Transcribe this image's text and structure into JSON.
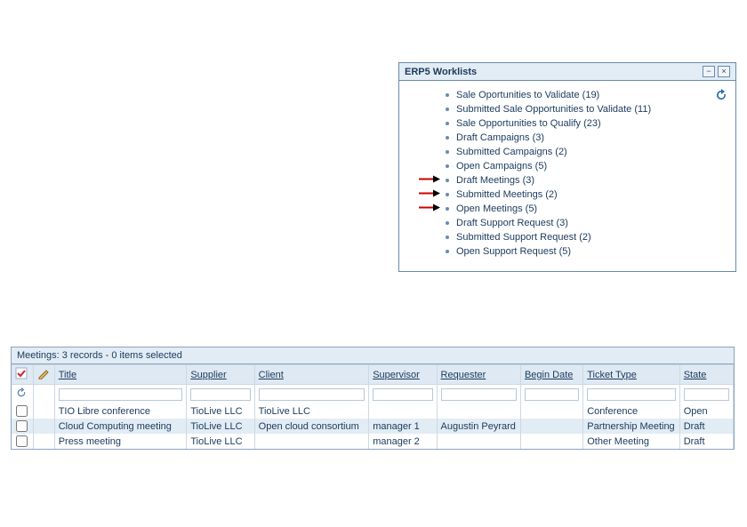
{
  "panel": {
    "title": "ERP5 Worklists",
    "minimize_glyph": "−",
    "close_glyph": "×",
    "items": [
      {
        "label": "Sale Oportunities to Validate (19)",
        "highlighted": false
      },
      {
        "label": "Submitted Sale Opportunities to Validate (11)",
        "highlighted": false
      },
      {
        "label": "Sale Opportunities to Qualify (23)",
        "highlighted": false
      },
      {
        "label": "Draft Campaigns (3)",
        "highlighted": false
      },
      {
        "label": "Submitted Campaigns (2)",
        "highlighted": false
      },
      {
        "label": "Open Campaigns (5)",
        "highlighted": false
      },
      {
        "label": "Draft Meetings (3)",
        "highlighted": true
      },
      {
        "label": "Submitted Meetings (2)",
        "highlighted": true
      },
      {
        "label": "Open Meetings (5)",
        "highlighted": true
      },
      {
        "label": "Draft Support Request (3)",
        "highlighted": false
      },
      {
        "label": "Submitted Support Request (2)",
        "highlighted": false
      },
      {
        "label": "Open Support Request (5)",
        "highlighted": false
      }
    ]
  },
  "meetings": {
    "caption": "Meetings: 3 records - 0 items selected",
    "columns": [
      "Title",
      "Supplier",
      "Client",
      "Supervisor",
      "Requester",
      "Begin Date",
      "Ticket Type",
      "State"
    ],
    "rows": [
      {
        "title": "TIO Libre conference",
        "supplier": "TioLive LLC",
        "client": "TioLive LLC",
        "supervisor": "",
        "requester": "",
        "begin_date": "",
        "ticket_type": "Conference",
        "state": "Open"
      },
      {
        "title": "Cloud Computing meeting",
        "supplier": "TioLive LLC",
        "client": "Open cloud consortium",
        "supervisor": "manager 1",
        "requester": "Augustin Peyrard",
        "begin_date": "",
        "ticket_type": "Partnership Meeting",
        "state": "Draft"
      },
      {
        "title": "Press meeting",
        "supplier": "TioLive LLC",
        "client": "",
        "supervisor": "manager 2",
        "requester": "",
        "begin_date": "",
        "ticket_type": "Other Meeting",
        "state": "Draft"
      }
    ]
  }
}
